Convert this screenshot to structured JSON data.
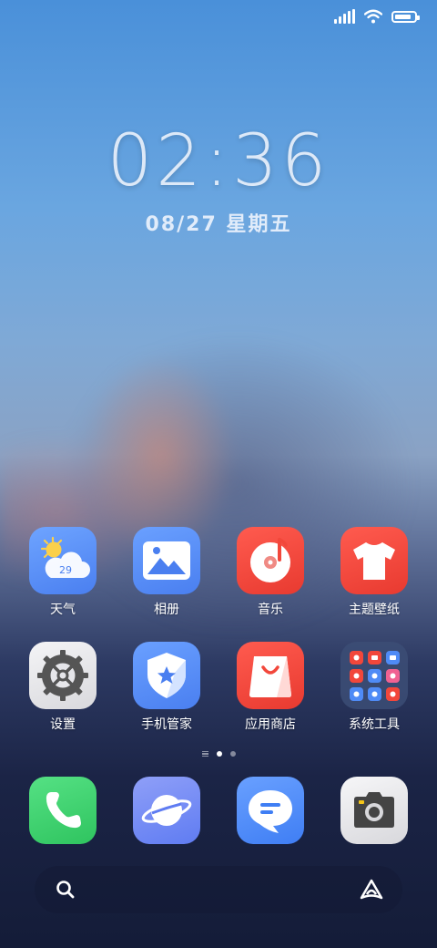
{
  "status_bar": {
    "signal_icon": "signal-bars-icon",
    "wifi_icon": "wifi-icon",
    "battery_icon": "battery-icon",
    "battery_level": 0.85
  },
  "clock": {
    "time": "02:36",
    "date": "08/27 星期五"
  },
  "apps": [
    {
      "label": "天气",
      "icon": "weather-icon",
      "temp": "29",
      "color": "#5b8ff5"
    },
    {
      "label": "相册",
      "icon": "gallery-icon",
      "color": "#4e86f4"
    },
    {
      "label": "音乐",
      "icon": "music-icon",
      "color": "#f2473b"
    },
    {
      "label": "主题壁纸",
      "icon": "theme-tshirt-icon",
      "color": "#f0413a"
    },
    {
      "label": "设置",
      "icon": "gear-icon",
      "color": "#e8e8ea"
    },
    {
      "label": "手机管家",
      "icon": "shield-star-icon",
      "color": "#4e86f4"
    },
    {
      "label": "应用商店",
      "icon": "shopping-bag-icon",
      "color": "#f2473b"
    },
    {
      "label": "系统工具",
      "icon": "folder-icon",
      "color": "#3b4b72"
    }
  ],
  "page_indicator": {
    "pages": 2,
    "active": 0
  },
  "dock": [
    {
      "name": "phone",
      "icon": "phone-icon",
      "color": "#3dd26e"
    },
    {
      "name": "browser",
      "icon": "planet-icon",
      "color": "#6e8cf5"
    },
    {
      "name": "messages",
      "icon": "message-icon",
      "color": "#4f8bf6"
    },
    {
      "name": "camera",
      "icon": "camera-icon",
      "color": "#e8e8ea"
    }
  ],
  "search_bar": {
    "search_icon": "search-icon",
    "assistant_icon": "assistant-icon"
  }
}
